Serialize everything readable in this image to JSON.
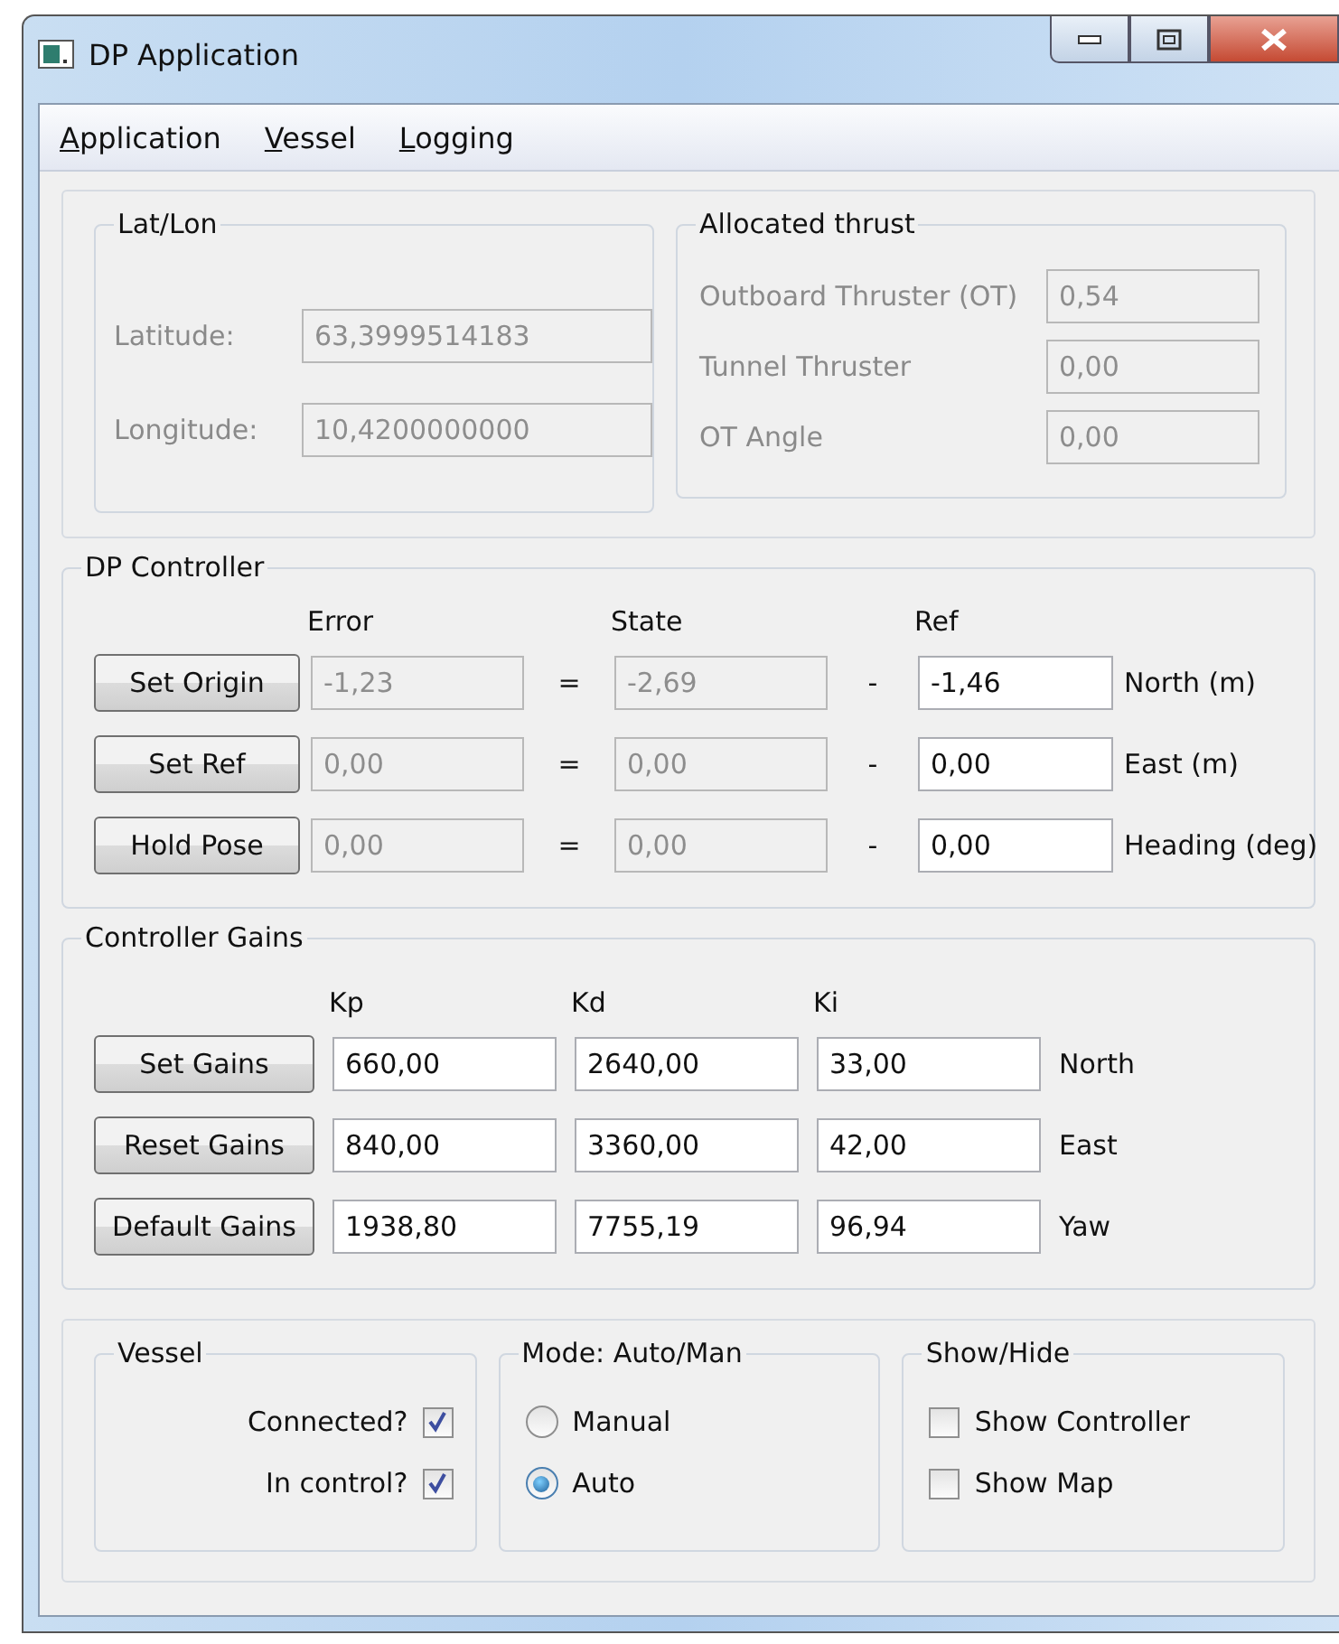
{
  "window": {
    "title": "DP Application"
  },
  "menu": [
    "Application",
    "Vessel",
    "Logging"
  ],
  "lat_lon": {
    "title": "Lat/Lon",
    "fields": [
      {
        "label": "Latitude:",
        "value": "63,3999514183",
        "disabled": true
      },
      {
        "label": "Longitude:",
        "value": "10,4200000000",
        "disabled": true
      }
    ]
  },
  "allocated_thrust": {
    "title": "Allocated thrust",
    "fields": [
      {
        "label": "Outboard Thruster (OT)",
        "value": "0,54",
        "disabled": true
      },
      {
        "label": "Tunnel Thruster",
        "value": "0,00",
        "disabled": true
      },
      {
        "label": "OT Angle",
        "value": "0,00",
        "disabled": true
      }
    ]
  },
  "dp_controller": {
    "title": "DP Controller",
    "columns": [
      "Error",
      "State",
      "Ref"
    ],
    "rows": [
      {
        "button": "Set Origin",
        "fields": [
          {
            "value": "-1,23",
            "disabled": true
          },
          {
            "value": "-2,69",
            "disabled": true
          },
          {
            "value": "-1,46",
            "disabled": false
          }
        ],
        "equals": "=",
        "minus": "-",
        "unit": "North (m)"
      },
      {
        "button": "Set Ref",
        "fields": [
          {
            "value": "0,00",
            "disabled": true
          },
          {
            "value": "0,00",
            "disabled": true
          },
          {
            "value": "0,00",
            "disabled": false
          }
        ],
        "equals": "=",
        "minus": "-",
        "unit": "East (m)"
      },
      {
        "button": "Hold Pose",
        "fields": [
          {
            "value": "0,00",
            "disabled": true
          },
          {
            "value": "0,00",
            "disabled": true
          },
          {
            "value": "0,00",
            "disabled": false
          }
        ],
        "equals": "=",
        "minus": "-",
        "unit": "Heading (deg)"
      }
    ]
  },
  "controller_gains": {
    "title": "Controller Gains",
    "columns": [
      "Kp",
      "Kd",
      "Ki"
    ],
    "rows": [
      {
        "button": "Set Gains",
        "values": [
          "660,00",
          "2640,00",
          "33,00"
        ],
        "axis": "North"
      },
      {
        "button": "Reset Gains",
        "values": [
          "840,00",
          "3360,00",
          "42,00"
        ],
        "axis": "East"
      },
      {
        "button": "Default Gains",
        "values": [
          "1938,80",
          "7755,19",
          "96,94"
        ],
        "axis": "Yaw"
      }
    ]
  },
  "vessel": {
    "title": "Vessel",
    "checkboxes": [
      {
        "label": "Connected?",
        "checked": true
      },
      {
        "label": "In control?",
        "checked": true
      }
    ]
  },
  "mode": {
    "title": "Mode: Auto/Man",
    "radios": [
      {
        "label": "Manual",
        "selected": false
      },
      {
        "label": "Auto",
        "selected": true
      }
    ]
  },
  "show_hide": {
    "title": "Show/Hide",
    "checkboxes": [
      {
        "label": "Show Controller",
        "checked": false
      },
      {
        "label": "Show Map",
        "checked": false
      }
    ]
  }
}
